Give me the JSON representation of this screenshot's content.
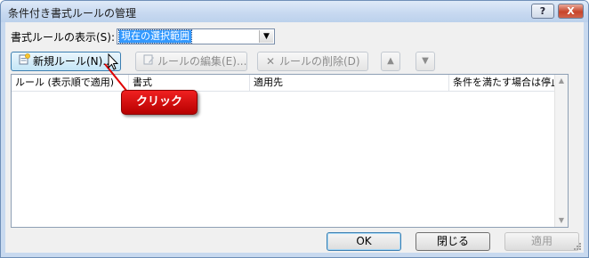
{
  "window": {
    "title": "条件付き書式ルールの管理"
  },
  "titlebar_buttons": {
    "help": "?",
    "close": "X"
  },
  "show_rules": {
    "label": "書式ルールの表示(S):",
    "selected": "現在の選択範囲"
  },
  "toolbar": {
    "new_rule": "新規ルール(N)...",
    "edit_rule": "ルールの編集(E)...",
    "delete_rule": "ルールの削除(D)"
  },
  "table": {
    "columns": [
      "ルール (表示順で適用)",
      "書式",
      "適用先",
      "条件を満たす場合は停止"
    ],
    "rows": []
  },
  "annotation": {
    "text": "クリック",
    "color": "#e00000"
  },
  "footer": {
    "ok": "OK",
    "close": "閉じる",
    "apply": "適用"
  },
  "colors": {
    "accent": "#3399ff",
    "window_frame": "#c8d9ef"
  }
}
